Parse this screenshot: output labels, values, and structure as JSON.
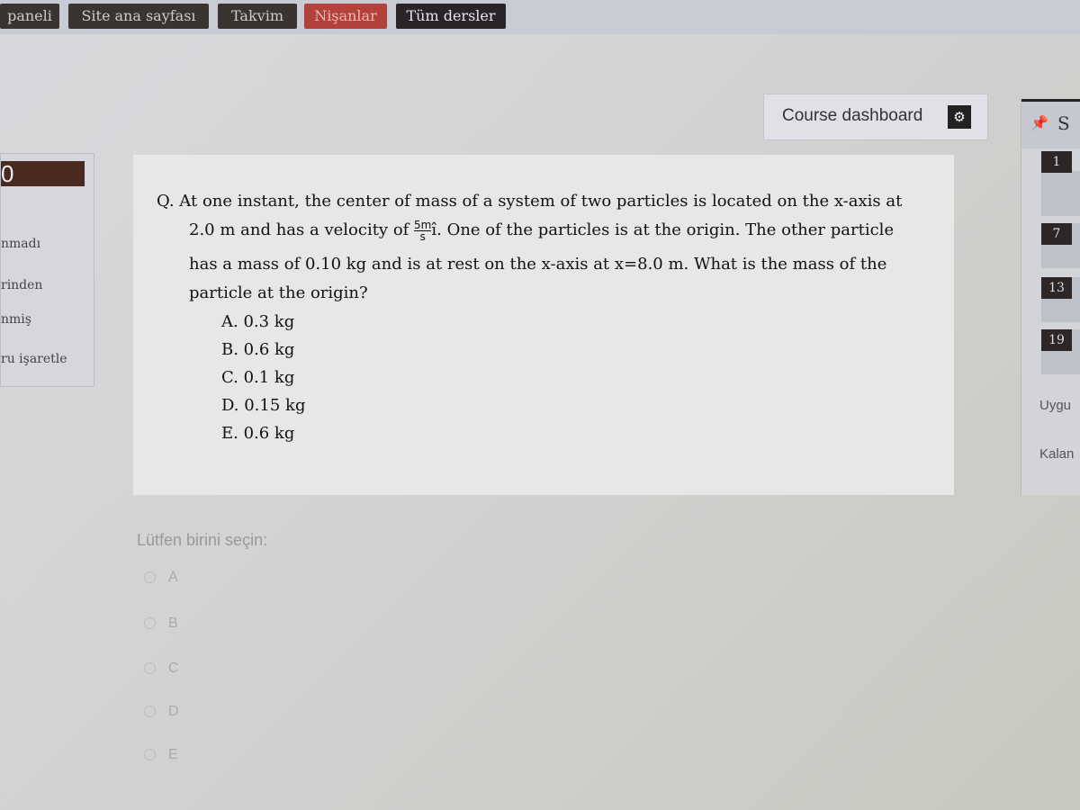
{
  "nav": {
    "items": [
      {
        "label": "paneli"
      },
      {
        "label": "Site ana sayfası"
      },
      {
        "label": "Takvim"
      },
      {
        "label": "Nişanlar",
        "active": true
      },
      {
        "label": "Tüm dersler"
      }
    ]
  },
  "dashboard": {
    "label": "Course dashboard",
    "icon": "gear-icon"
  },
  "left_panel": {
    "score": "0",
    "lines": [
      "nmadı",
      "rinden",
      "nmiş",
      "ru işaretle"
    ]
  },
  "question": {
    "line1": "Q. At one instant, the center of mass of a system of two particles is located on the x-axis at",
    "line2_pre": "2.0 m and has a velocity of ",
    "frac_num": "5m",
    "frac_den": "s",
    "vector": "ı̂",
    "line2_post": ". One of the particles is at the origin. The other particle",
    "line3": "has a mass of 0.10 kg and is at rest on the x-axis at x=8.0 m.  What is the mass of the",
    "line4": "particle at the origin?",
    "options": [
      "A.  0.3 kg",
      "B.  0.6 kg",
      "C.  0.1 kg",
      "D.  0.15 kg",
      "E.  0.6 kg"
    ]
  },
  "answer": {
    "prompt": "Lütfen birini seçin:",
    "choices": [
      "A",
      "B",
      "C",
      "D",
      "E"
    ]
  },
  "right_panel": {
    "header": "S",
    "question_numbers": [
      "1",
      "7",
      "13",
      "19"
    ],
    "labels": [
      "Uygu",
      "Kalan"
    ]
  }
}
